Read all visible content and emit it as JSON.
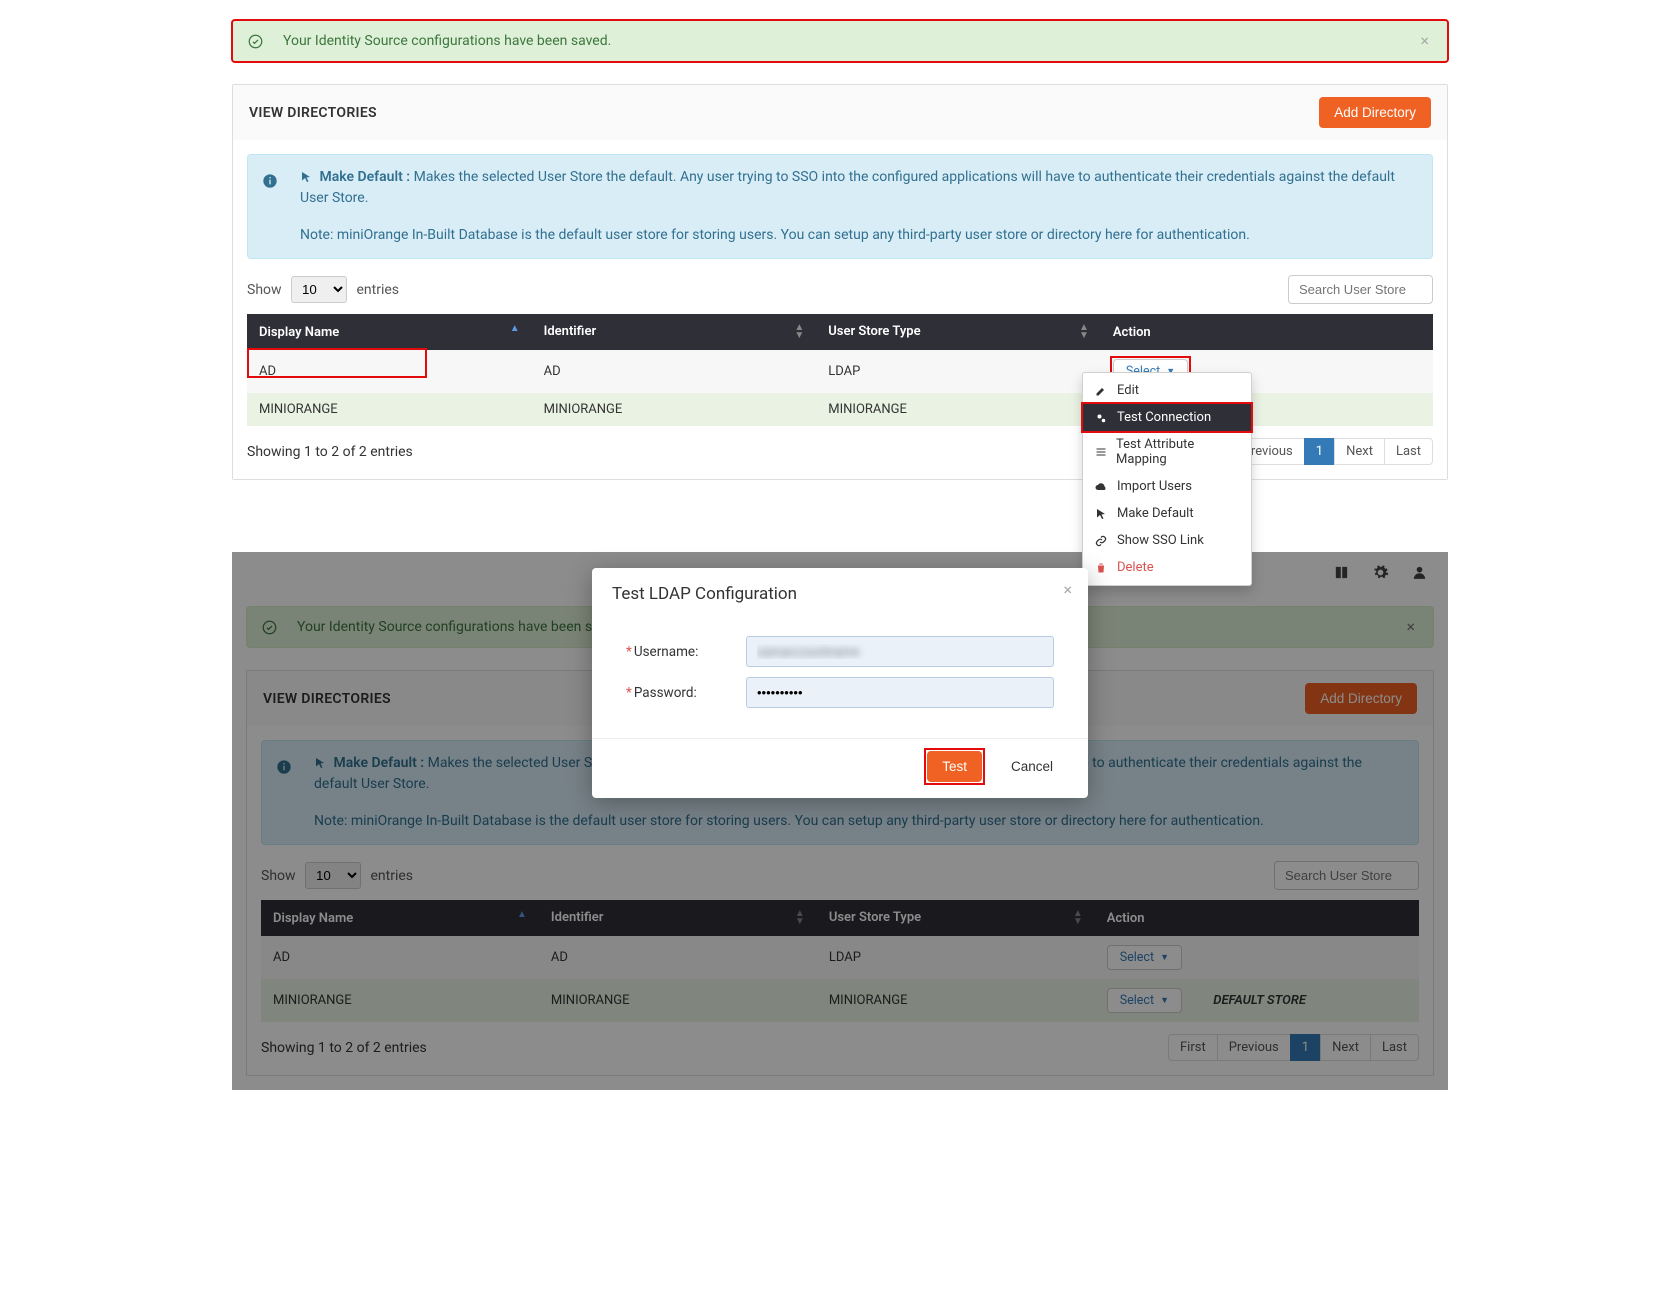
{
  "alert": {
    "text": "Your Identity Source configurations have been saved.",
    "close_glyph": "×"
  },
  "card": {
    "title": "VIEW DIRECTORIES",
    "add_btn": "Add Directory"
  },
  "info": {
    "make_default_label": "Make Default :",
    "make_default_text": " Makes the selected User Store the default. Any user trying to SSO into the configured applications will have to authenticate their credentials against the default User Store.",
    "note_text": "Note: miniOrange In-Built Database is the default user store for storing users. You can setup any third-party user store or directory here for authentication."
  },
  "table": {
    "show_label": "Show",
    "entries_label": "entries",
    "page_size": "10",
    "search_placeholder": "Search User Store",
    "headers": {
      "display_name": "Display Name",
      "identifier": "Identifier",
      "user_store_type": "User Store Type",
      "action": "Action"
    },
    "rows": [
      {
        "display_name": "AD",
        "identifier": "AD",
        "user_store_type": "LDAP"
      },
      {
        "display_name": "MINIORANGE",
        "identifier": "MINIORANGE",
        "user_store_type": "MINIORANGE"
      }
    ],
    "select_label": "Select",
    "default_store_label": "DEFAULT STORE",
    "footer_info": "Showing 1 to 2 of 2 entries",
    "pager": {
      "first": "First",
      "prev": "Previous",
      "page1": "1",
      "next": "Next",
      "last": "Last"
    }
  },
  "dropdown": {
    "edit": "Edit",
    "test_connection": "Test Connection",
    "test_attr": "Test Attribute Mapping",
    "import_users": "Import Users",
    "make_default": "Make Default",
    "show_sso": "Show SSO Link",
    "delete": "Delete"
  },
  "modal": {
    "title": "Test LDAP Configuration",
    "username_label": "Username:",
    "password_label": "Password:",
    "username_value": "samaccountname",
    "password_value": "••••••••••",
    "test": "Test",
    "cancel": "Cancel",
    "close_glyph": "×"
  }
}
